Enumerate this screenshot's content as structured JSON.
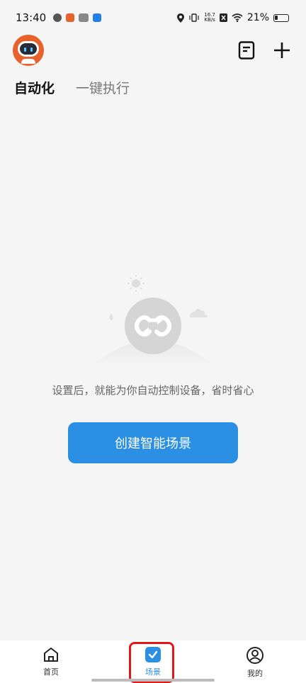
{
  "status_bar": {
    "time": "13:40",
    "net_speed_value": "16.7",
    "net_speed_unit": "KB/s",
    "battery": "21%",
    "battery_level": 0.21
  },
  "header": {
    "avatar_icon": "robot-avatar-icon",
    "actions": [
      "log-icon",
      "add-icon"
    ]
  },
  "tabs": [
    {
      "label": "自动化",
      "active": true
    },
    {
      "label": "一键执行",
      "active": false
    }
  ],
  "empty_state": {
    "message": "设置后，就能为你自动控制设备，省时省心",
    "button_label": "创建智能场景"
  },
  "bottom_nav": [
    {
      "label": "首页",
      "icon": "home-icon",
      "active": false
    },
    {
      "label": "场景",
      "icon": "scene-check-icon",
      "active": true
    },
    {
      "label": "我的",
      "icon": "profile-icon",
      "active": false
    }
  ],
  "colors": {
    "accent": "#2b8fe3",
    "highlight": "#e01818",
    "avatar": "#e8632b"
  }
}
